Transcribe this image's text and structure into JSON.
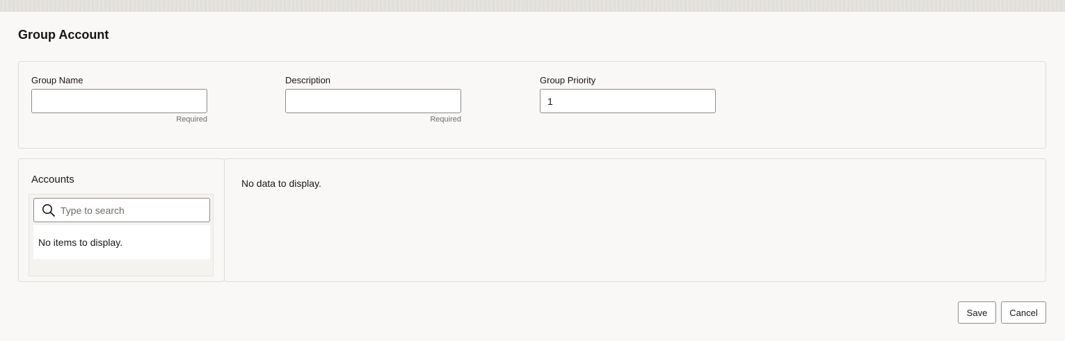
{
  "page": {
    "title": "Group Account"
  },
  "form": {
    "group_name": {
      "label": "Group Name",
      "value": "",
      "hint": "Required"
    },
    "description": {
      "label": "Description",
      "value": "",
      "hint": "Required"
    },
    "group_priority": {
      "label": "Group Priority",
      "value": "1"
    }
  },
  "accounts": {
    "title": "Accounts",
    "search_placeholder": "Type to search",
    "empty_text": "No items to display.",
    "icon": "search-icon"
  },
  "detail": {
    "empty_text": "No data to display."
  },
  "actions": {
    "save_label": "Save",
    "cancel_label": "Cancel"
  },
  "colors": {
    "background": "#f9f8f6",
    "border": "#dfdcd8",
    "input_border": "#8d8b87",
    "text": "#161513",
    "muted_text": "#6f6c68"
  }
}
